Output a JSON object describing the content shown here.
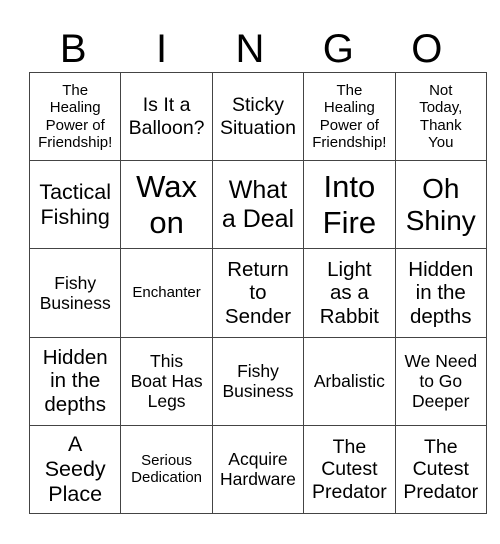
{
  "header": [
    "B",
    "I",
    "N",
    "G",
    "O"
  ],
  "cells": [
    [
      "The\nHealing\nPower of\nFriendship!",
      "Is It a\nBalloon?",
      "Sticky\nSituation",
      "The\nHealing\nPower of\nFriendship!",
      "Not\nToday,\nThank\nYou"
    ],
    [
      "Tactical\nFishing",
      "Wax\non",
      "What\na Deal",
      "Into\nFire",
      "Oh\nShiny"
    ],
    [
      "Fishy\nBusiness",
      "Enchanter",
      "Return\nto\nSender",
      "Light\nas a\nRabbit",
      "Hidden\nin the\ndepths"
    ],
    [
      "Hidden\nin the\ndepths",
      "This\nBoat Has\nLegs",
      "Fishy\nBusiness",
      "Arbalistic",
      "We Need\nto Go\nDeeper"
    ],
    [
      "A\nSeedy\nPlace",
      "Serious\nDedication",
      "Acquire\nHardware",
      "The\nCutest\nPredator",
      "The\nCutest\nPredator"
    ]
  ]
}
